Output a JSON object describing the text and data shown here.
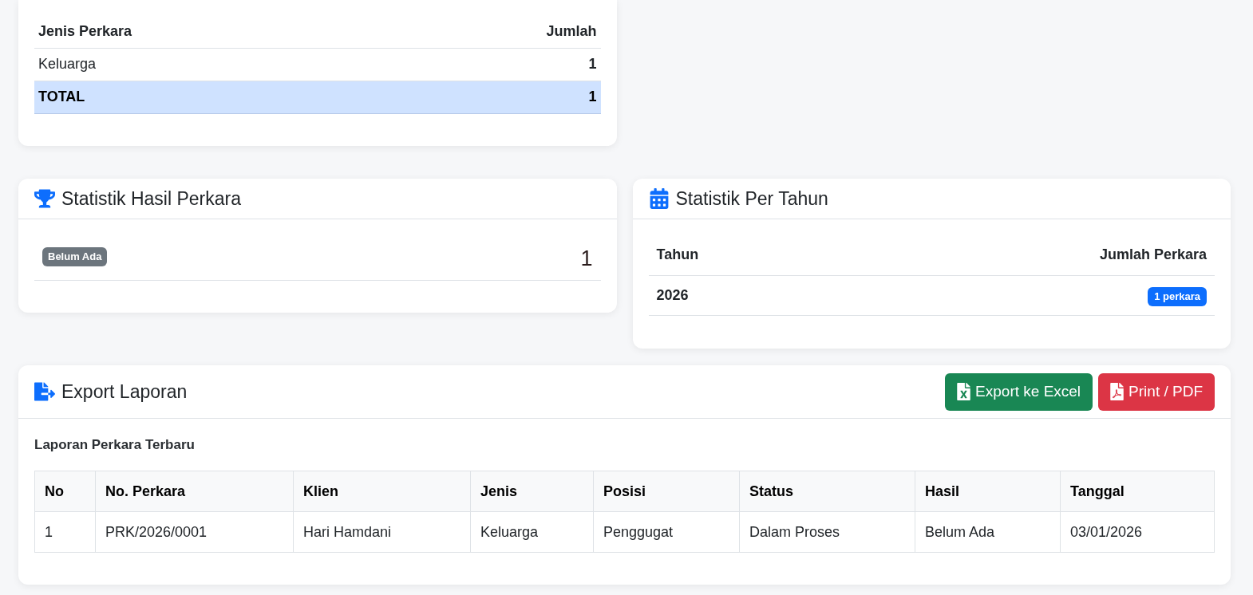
{
  "jenis_perkara": {
    "columns": [
      "Jenis Perkara",
      "Jumlah"
    ],
    "rows": [
      {
        "jenis": "Keluarga",
        "jumlah": "1"
      }
    ],
    "total": {
      "label": "TOTAL",
      "value": "1"
    }
  },
  "hasil_perkara": {
    "title": "Statistik Hasil Perkara",
    "rows": [
      {
        "badge": "Belum Ada",
        "count": "1"
      }
    ]
  },
  "per_tahun": {
    "title": "Statistik Per Tahun",
    "columns": [
      "Tahun",
      "Jumlah Perkara"
    ],
    "rows": [
      {
        "tahun": "2026",
        "badge": "1 perkara"
      }
    ]
  },
  "export_laporan": {
    "title": "Export Laporan",
    "buttons": [
      {
        "label": "Export ke Excel",
        "kind": "excel"
      },
      {
        "label": "Print / PDF",
        "kind": "pdf"
      }
    ],
    "subtitle": "Laporan Perkara Terbaru",
    "table": {
      "columns": [
        "No",
        "No. Perkara",
        "Klien",
        "Jenis",
        "Posisi",
        "Status",
        "Hasil",
        "Tanggal"
      ],
      "rows": [
        [
          "1",
          "PRK/2026/0001",
          "Hari Hamdani",
          "Keluarga",
          "Penggugat",
          "Dalam Proses",
          "Belum Ada",
          "03/01/2026"
        ]
      ]
    }
  }
}
